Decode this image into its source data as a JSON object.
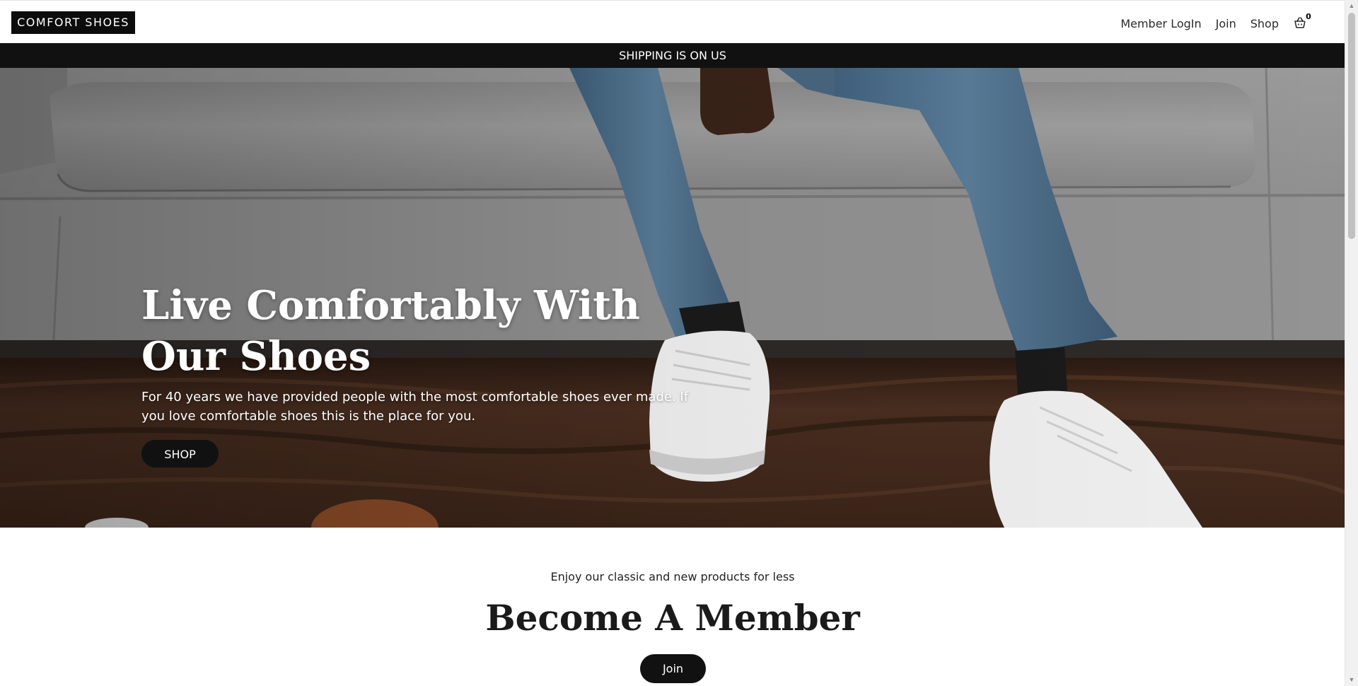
{
  "header": {
    "logo_text": "COMFORT SHOES",
    "nav": {
      "member_login": "Member LogIn",
      "join": "Join",
      "shop": "Shop"
    },
    "cart_count": "0"
  },
  "promo_bar": {
    "text": "SHIPPING IS ON US"
  },
  "hero": {
    "title": "Live Comfortably With Our Shoes",
    "description": "For 40 years we have provided people with the most comfortable shoes ever made. If you love comfortable shoes this is the place for you.",
    "shop_button": "SHOP"
  },
  "member_section": {
    "subtitle": "Enjoy our classic and new products for less",
    "title": "Become A Member",
    "join_button": "Join"
  },
  "colors": {
    "dark": "#111111",
    "white": "#ffffff"
  }
}
